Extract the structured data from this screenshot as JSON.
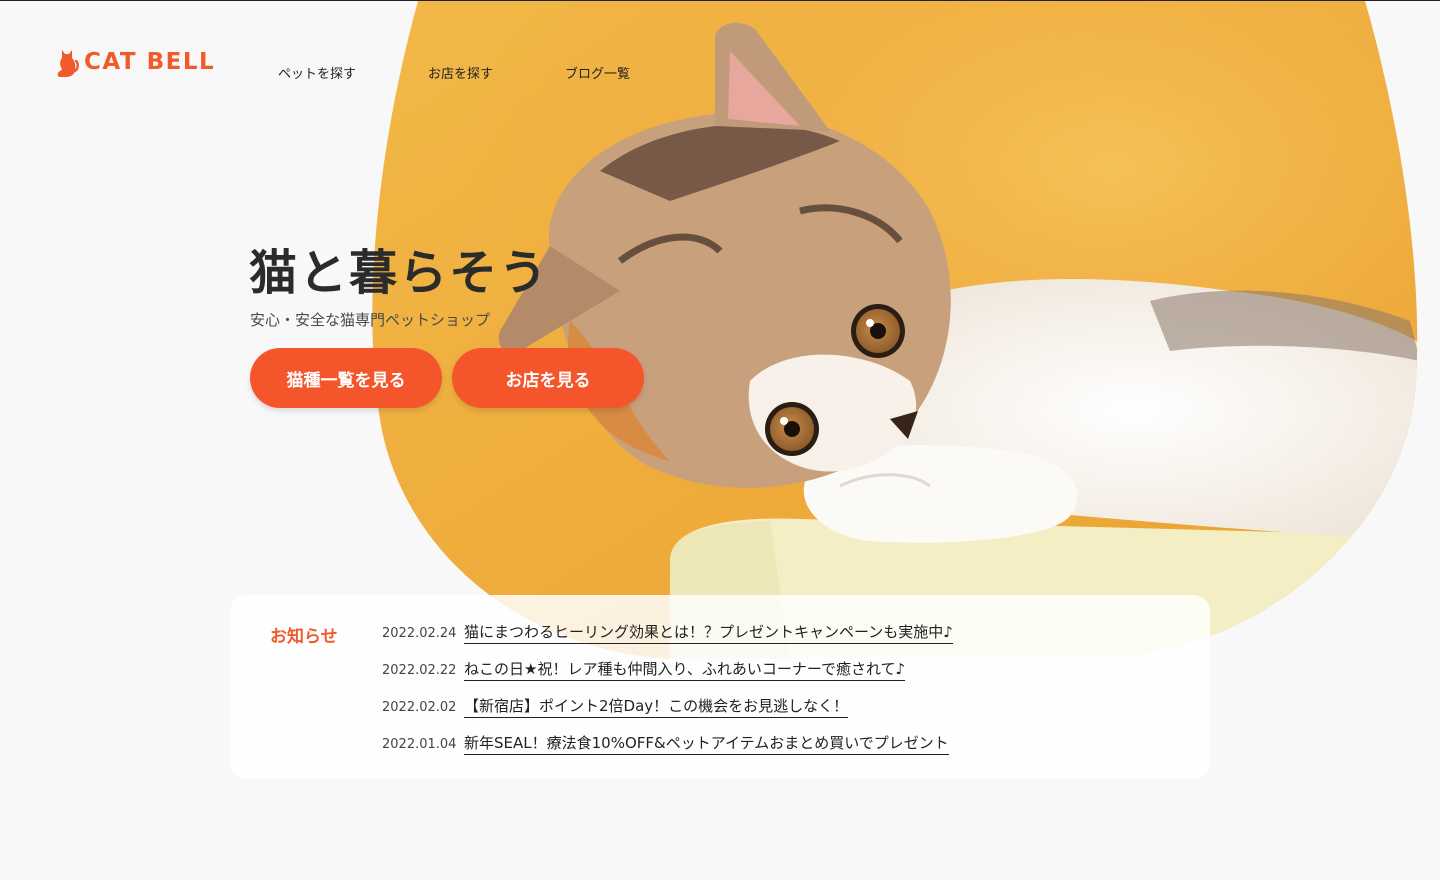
{
  "brand": {
    "name": "CAT BELL",
    "color": "#f15a2b",
    "icon": "cat-silhouette-icon"
  },
  "nav": {
    "items": [
      "ペットを探す",
      "お店を探す",
      "ブログ一覧"
    ]
  },
  "hero": {
    "title": "猫と暮らそう",
    "subtitle": "安心・安全な猫専門ペットショップ",
    "buttons": [
      "猫種一覧を見る",
      "お店を見る"
    ],
    "button_color": "#f4552a",
    "image": "kitten-photo"
  },
  "news": {
    "heading": "お知らせ",
    "items": [
      {
        "date": "2022.02.24",
        "title": "猫にまつわるヒーリング効果とは！？プレゼントキャンペーンも実施中♪"
      },
      {
        "date": "2022.02.22",
        "title": "ねこの日★祝！レア種も仲間入り、ふれあいコーナーで癒されて♪"
      },
      {
        "date": "2022.02.02",
        "title": "【新宿店】ポイント2倍Day！この機会をお見逃しなく！"
      },
      {
        "date": "2022.01.04",
        "title": "新年SEAL！療法食10%OFF&ペットアイテムおまとめ買いでプレゼント"
      }
    ]
  }
}
